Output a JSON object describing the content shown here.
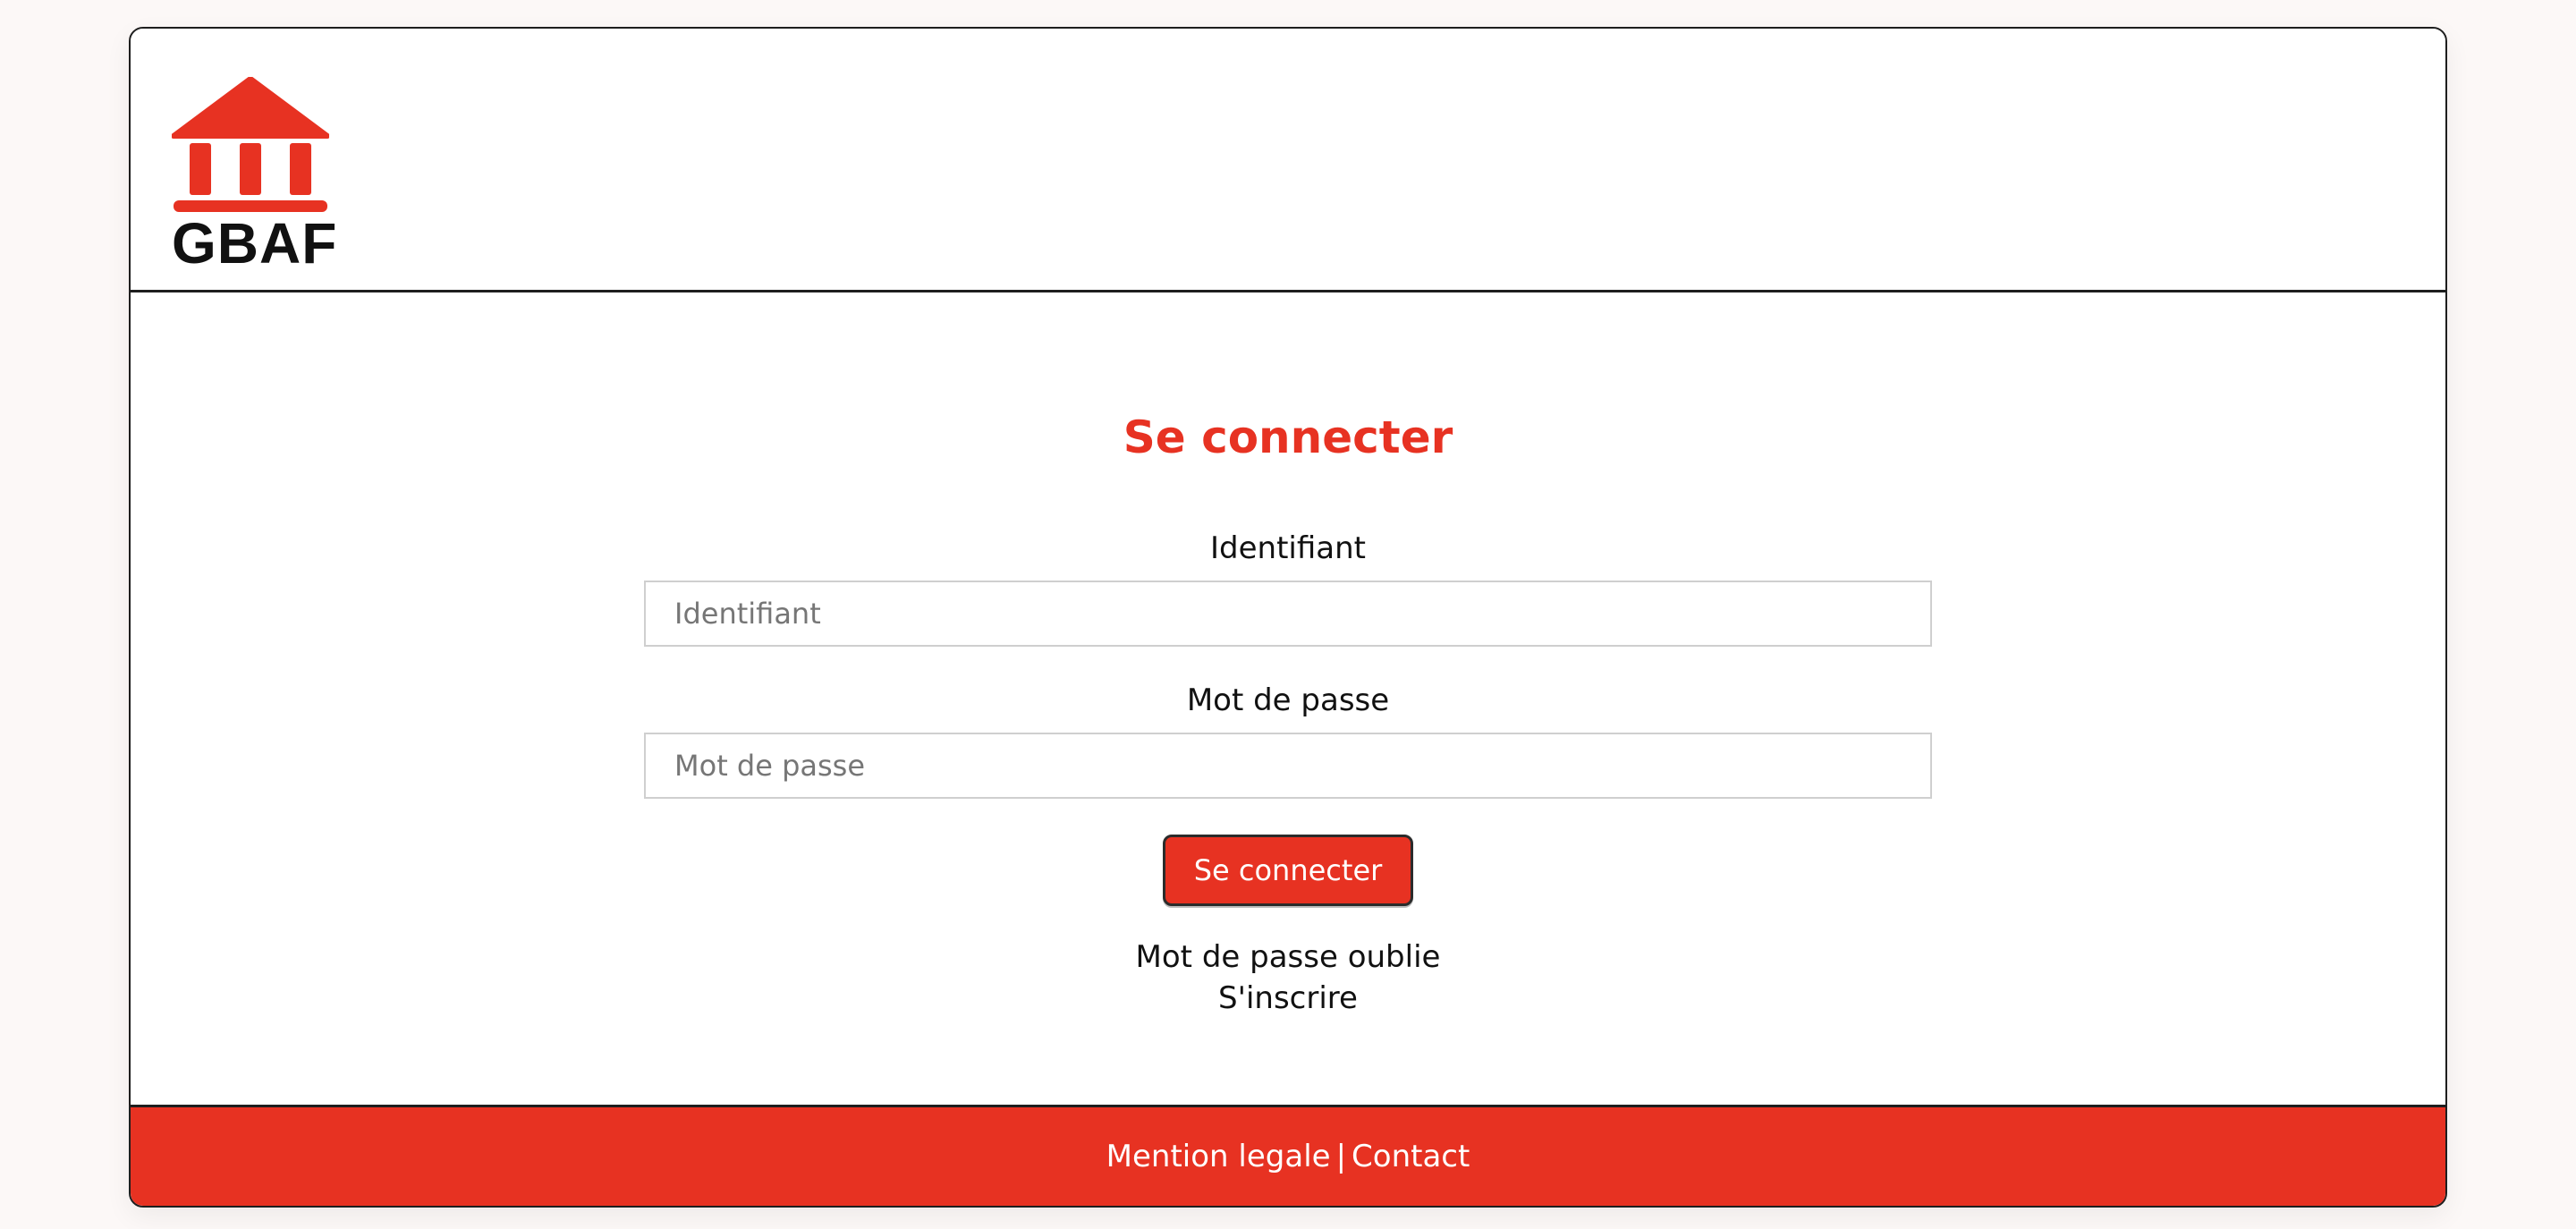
{
  "header": {
    "logo_text": "GBAF"
  },
  "login": {
    "title": "Se connecter",
    "username_label": "Identifiant",
    "username_placeholder": "Identifiant",
    "username_value": "",
    "password_label": "Mot de passe",
    "password_placeholder": "Mot de passe",
    "password_value": "",
    "submit_label": "Se connecter",
    "forgot_password": "Mot de passe oublie",
    "register": "S'inscrire"
  },
  "footer": {
    "legal": "Mention legale",
    "separator": "|",
    "contact": "Contact"
  },
  "colors": {
    "brand": "#e73222",
    "page_background": "#fcf8f7",
    "text": "#111111"
  },
  "icons": {
    "logo": "bank-building-icon"
  }
}
